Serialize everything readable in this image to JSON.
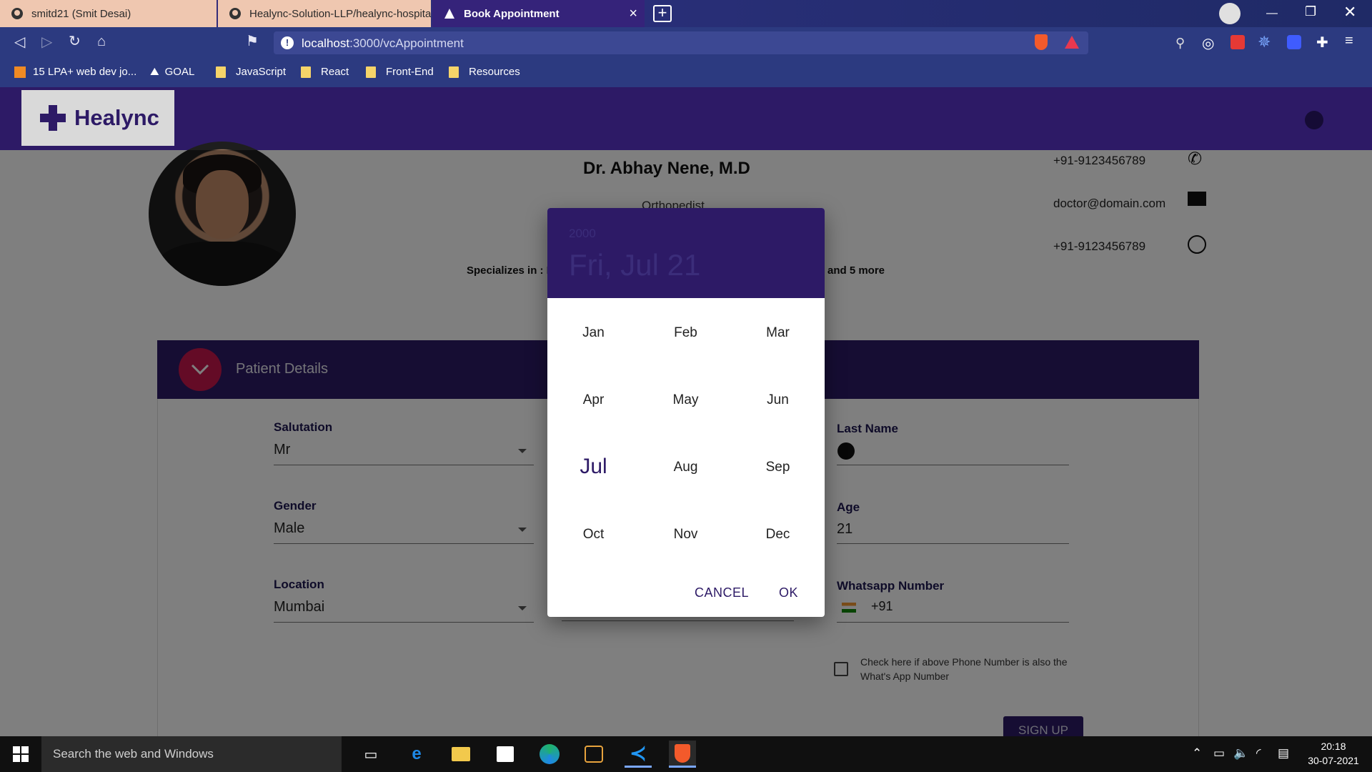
{
  "browser": {
    "tabs": [
      {
        "label": "smitd21 (Smit Desai)"
      },
      {
        "label": "Healync-Solution-LLP/healync-hospita"
      },
      {
        "label": "Book Appointment"
      }
    ],
    "url_host": "localhost",
    "url_path": ":3000/vcAppointment",
    "bookmarks": [
      "15 LPA+ web dev jo...",
      "GOAL",
      "JavaScript",
      "React",
      "Front-End",
      "Resources"
    ]
  },
  "app": {
    "logo_text": "Healync"
  },
  "doctor": {
    "name": "Dr. Abhay Nene, M.D",
    "specialty": "Orthopedist",
    "specializes_prefix": "Specializes in : N",
    "specializes_more": "and 5 more",
    "phone": "+91-9123456789",
    "email": "doctor@domain.com",
    "whatsapp": "+91-9123456789"
  },
  "panel": {
    "title": "Patient Details",
    "fields": {
      "salutation_label": "Salutation",
      "salutation_value": "Mr",
      "gender_label": "Gender",
      "gender_value": "Male",
      "location_label": "Location",
      "location_value": "Mumbai",
      "last_name_label": "Last Name",
      "age_label": "Age",
      "age_value": "21",
      "whatsapp_label": "Whatsapp Number",
      "whatsapp_prefix": "+91"
    },
    "checkbox_text": "Check here if above Phone Number is also the What's App Number",
    "signup_label": "SIGN UP"
  },
  "datepicker": {
    "year": "2000",
    "date_display": "Fri, Jul 21",
    "months": [
      "Jan",
      "Feb",
      "Mar",
      "Apr",
      "May",
      "Jun",
      "Jul",
      "Aug",
      "Sep",
      "Oct",
      "Nov",
      "Dec"
    ],
    "selected_month": "Jul",
    "cancel_label": "CANCEL",
    "ok_label": "OK"
  },
  "taskbar": {
    "search_placeholder": "Search the web and Windows",
    "time": "20:18",
    "date": "30-07-2021"
  },
  "colors": {
    "brand": "#2d1a66",
    "accent": "#c8174d"
  }
}
